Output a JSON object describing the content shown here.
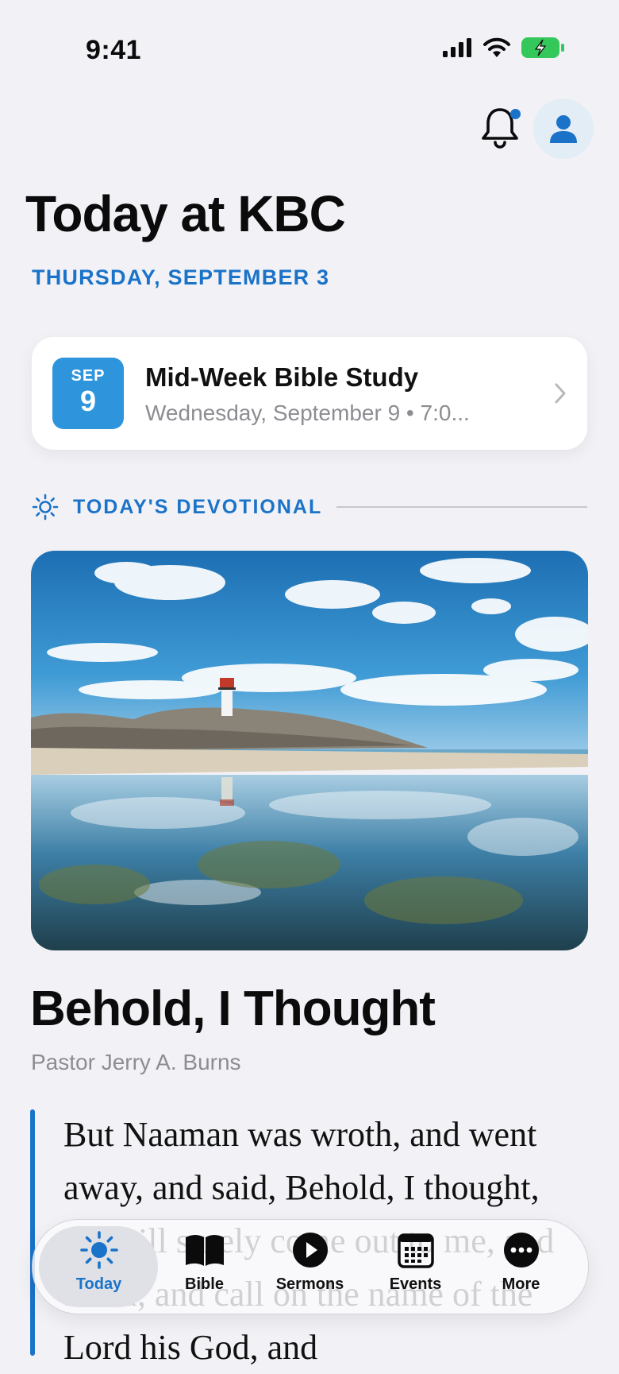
{
  "status_bar": {
    "time": "9:41"
  },
  "header": {
    "notification_icon": "bell-icon",
    "profile_icon": "person-icon"
  },
  "page": {
    "title": "Today at KBC",
    "date": "THURSDAY, SEPTEMBER 3"
  },
  "event": {
    "month": "SEP",
    "day": "9",
    "title": "Mid-Week Bible Study",
    "subtitle": "Wednesday, September 9 • 7:0..."
  },
  "devotional": {
    "section_label": "TODAY'S DEVOTIONAL",
    "title": "Behold, I Thought",
    "author": "Pastor Jerry A. Burns",
    "quote": "But Naaman was wroth, and went away, and said, Behold, I thought, He will surely come out to me, and stand, and call on the name of the Lord his God, and"
  },
  "tabs": [
    {
      "label": "Today",
      "icon": "sun-icon",
      "active": true
    },
    {
      "label": "Bible",
      "icon": "book-icon"
    },
    {
      "label": "Sermons",
      "icon": "play-icon"
    },
    {
      "label": "Events",
      "icon": "calendar-icon"
    },
    {
      "label": "More",
      "icon": "more-icon"
    }
  ],
  "colors": {
    "accent": "#1a73c9",
    "badge": "#2e95dd",
    "background": "#f2f2f6",
    "battery": "#34c759"
  }
}
